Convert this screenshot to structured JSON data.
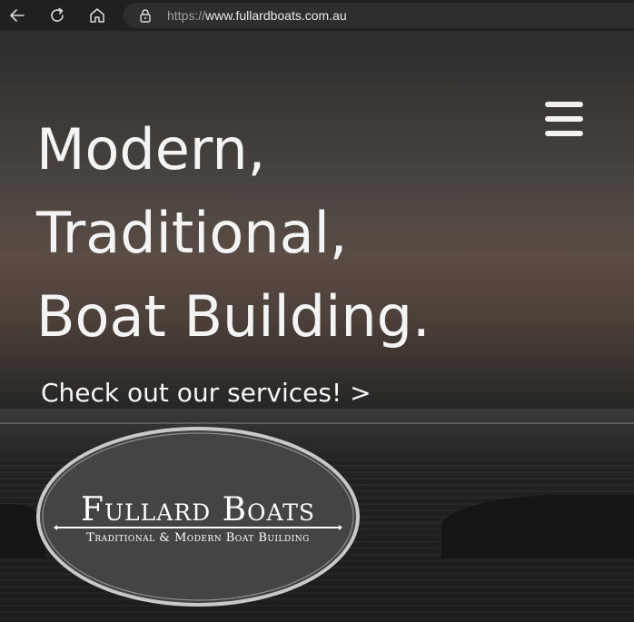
{
  "browser": {
    "url_scheme": "https://",
    "url_host": "www.fullardboats.com.au",
    "icons": [
      "back-arrow-icon",
      "reload-icon",
      "home-icon",
      "site-info-lock-icon"
    ]
  },
  "hero": {
    "headline_lines": [
      "Modern,",
      "Traditional,",
      "Boat Building."
    ],
    "cta_label": "Check out our services! >",
    "menu_icon": "hamburger-menu-icon"
  },
  "logo": {
    "title": "Fullard Boats",
    "subtitle": "Traditional & Modern Boat Building"
  },
  "colors": {
    "browser_bar": "#202020",
    "omnibox": "#2e2e2e",
    "headline_text": "#f4f4f4",
    "logo_fill": "#444444",
    "logo_border": "#c8c8c8"
  }
}
